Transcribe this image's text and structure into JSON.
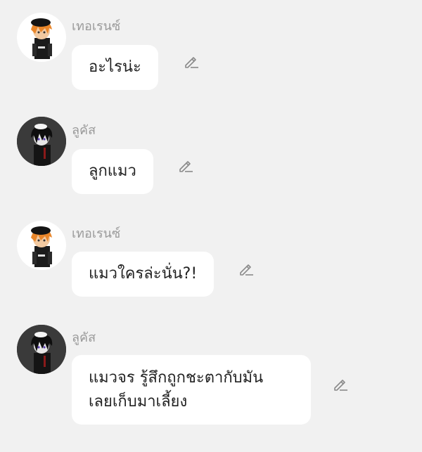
{
  "messages": [
    {
      "sender": "เทอเรนซ์",
      "avatar": "avatar-terrence",
      "lines": [
        "อะไรน่ะ"
      ],
      "edit_icon": "pencil-icon"
    },
    {
      "sender": "ลูคัส",
      "avatar": "avatar-lucas",
      "lines": [
        "ลูกแมว"
      ],
      "edit_icon": "pencil-icon"
    },
    {
      "sender": "เทอเรนซ์",
      "avatar": "avatar-terrence",
      "lines": [
        "แมวใครล่ะนั่น?!"
      ],
      "edit_icon": "pencil-icon"
    },
    {
      "sender": "ลูคัส",
      "avatar": "avatar-lucas",
      "lines": [
        "แมวจร รู้สึกถูกชะตากับมัน",
        "เลยเก็บมาเลี้ยง"
      ],
      "edit_icon": "pencil-icon"
    }
  ],
  "colors": {
    "background": "#f1f1f1",
    "bubble": "#ffffff",
    "sender_name": "#9a9a9a",
    "text": "#222222",
    "icon": "#8a8a8a"
  }
}
